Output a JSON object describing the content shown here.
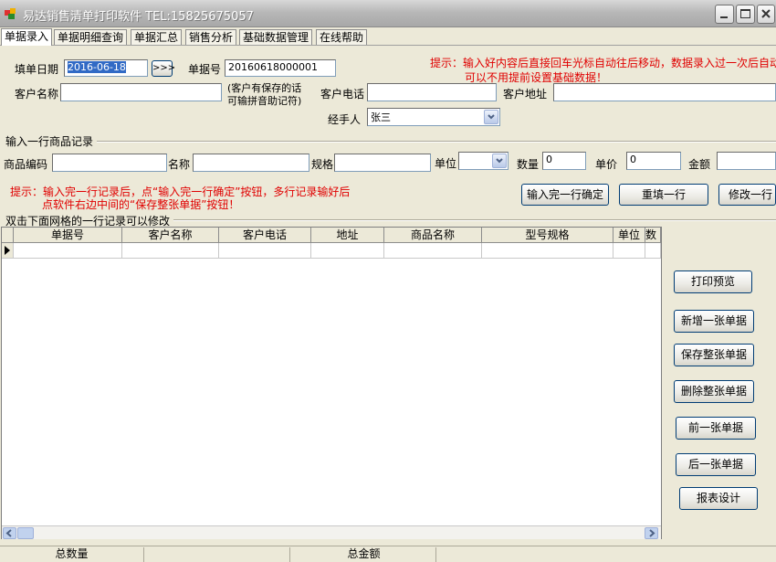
{
  "window": {
    "title": "易达销售清单打印软件 TEL:15825675057"
  },
  "menu": {
    "tabs": [
      "单据录入",
      "单据明细查询",
      "单据汇总",
      "销售分析",
      "基础数据管理",
      "在线帮助"
    ]
  },
  "header": {
    "date_label": "填单日期",
    "date_value": "2016-06-18",
    "date_button": ">>>",
    "doc_no_label": "单据号",
    "doc_no_value": "20160618000001",
    "tip_line1": "提示：输入好内容后直接回车光标自动往后移动，数据录入过一次后自动",
    "tip_line2": "可以不用提前设置基础数据！",
    "customer_name_label": "客户名称",
    "customer_name_value": "",
    "customer_hint_line1": "(客户有保存的话",
    "customer_hint_line2": "可输拼音助记符)",
    "customer_phone_label": "客户电话",
    "customer_phone_value": "",
    "customer_address_label": "客户地址",
    "customer_address_value": "",
    "handler_label": "经手人",
    "handler_value": "张三"
  },
  "item_entry": {
    "section_title": "输入一行商品记录",
    "code_label": "商品编码",
    "name_label": "名称",
    "spec_label": "规格",
    "unit_label": "单位",
    "qty_label": "数量",
    "qty_value": "0",
    "price_label": "单价",
    "price_value": "0",
    "amount_label": "金额",
    "amount_value": "",
    "tip_line1": "提示：输入完一行记录后，点“输入完一行确定”按钮，多行记录输好后",
    "tip_line2": "点软件右边中间的“保存整张单据”按钮！",
    "confirm_button": "输入完一行确定",
    "refill_button": "重填一行",
    "modify_button": "修改一行"
  },
  "grid": {
    "caption": "双击下面网格的一行记录可以修改",
    "columns": [
      "单据号",
      "客户名称",
      "客户电话",
      "地址",
      "商品名称",
      "型号规格",
      "单位",
      "数量"
    ]
  },
  "actions": {
    "print_preview": "打印预览",
    "new_doc": "新增一张单据",
    "save_doc": "保存整张单据",
    "delete_doc": "删除整张单据",
    "prev_doc": "前一张单据",
    "next_doc": "后一张单据",
    "report_design": "报表设计"
  },
  "status": {
    "total_qty_label": "总数量",
    "total_amount_label": "总金额"
  },
  "colors": {
    "tip_red": "#e00000",
    "selection_blue": "#316ac5"
  }
}
